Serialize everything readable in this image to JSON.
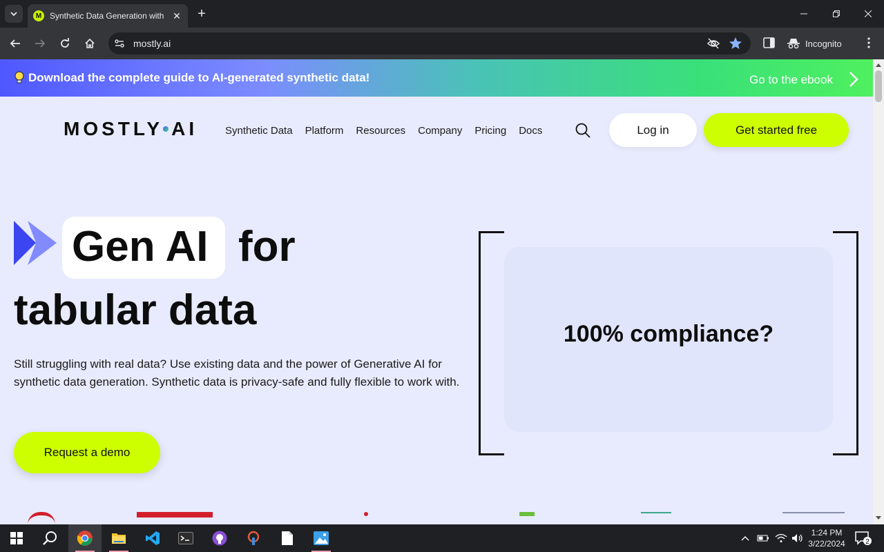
{
  "browser": {
    "tab_title": "Synthetic Data Generation with",
    "favicon_letter": "M",
    "url": "mostly.ai",
    "incognito_label": "Incognito"
  },
  "banner": {
    "message": "Download the complete guide to AI-generated synthetic data!",
    "cta": "Go to the ebook"
  },
  "header": {
    "logo_left": "MOSTLY",
    "logo_right": "AI",
    "nav": [
      "Synthetic Data",
      "Platform",
      "Resources",
      "Company",
      "Pricing",
      "Docs"
    ],
    "login": "Log in",
    "get_started": "Get started free"
  },
  "hero": {
    "highlight": "Gen AI",
    "word_for": "for",
    "line2": "tabular data",
    "description": "Still struggling with real data? Use existing data and the power of Generative AI for synthetic data generation. Synthetic data is privacy-safe and fully flexible to work with.",
    "demo_button": "Request a demo",
    "claim": "100% compliance?"
  },
  "colors": {
    "accent_lime": "#cdff00",
    "brand_blue": "#4f58ff",
    "page_bg": "#e8ebfd"
  },
  "taskbar": {
    "time": "1:24 PM",
    "date": "3/22/2024",
    "notification_count": "2"
  }
}
